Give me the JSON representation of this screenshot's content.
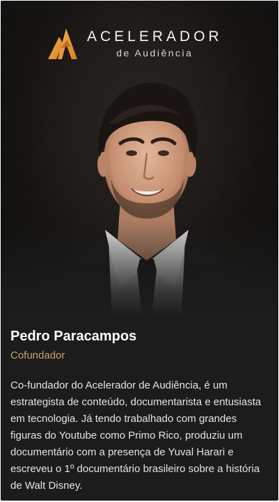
{
  "brand": {
    "title": "ACELERADOR",
    "subtitle": "de Audiência",
    "icon": "brand-logo-mark",
    "accent_color": "#e29a3d"
  },
  "profile": {
    "name": "Pedro Paracampos",
    "role": "Cofundador",
    "role_color": "#c9a46a",
    "bio": "Co-fundador do Acelerador de Audiência, é um estrategista de conteúdo, documentarista e entusiasta em tecnologia. Já tendo trabalhado com grandes figuras do Youtube como Primo Rico, produziu um documentário com a presença de Yuval Harari e escreveu o 1º documentário brasileiro sobre a história de Walt Disney."
  }
}
